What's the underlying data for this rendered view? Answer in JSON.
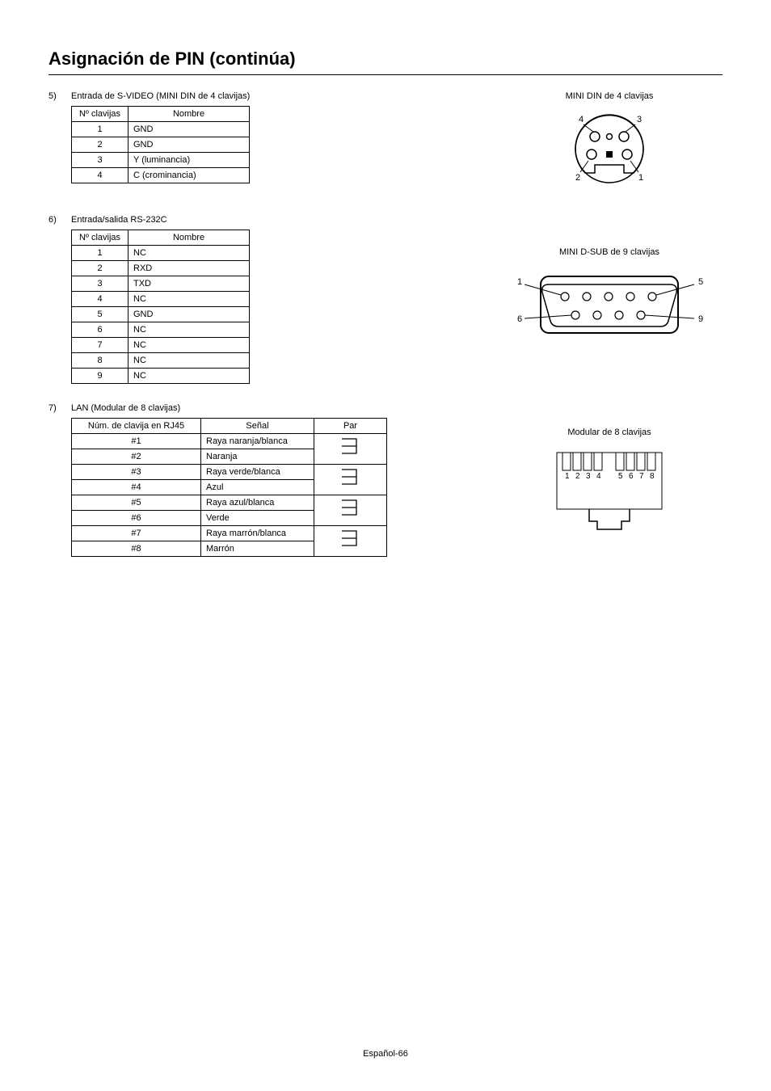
{
  "page_title": "Asignación de PIN (continúa)",
  "section5": {
    "num": "5)",
    "title": "Entrada de S-VIDEO (MINI DIN de 4 clavijas)",
    "diagram_title": "MINI DIN de 4 clavijas",
    "headers": [
      "Nº clavijas",
      "Nombre"
    ],
    "rows": [
      [
        "1",
        "GND"
      ],
      [
        "2",
        "GND"
      ],
      [
        "3",
        "Y (luminancia)"
      ],
      [
        "4",
        "C (crominancia)"
      ]
    ],
    "pin_labels": {
      "tl": "4",
      "tr": "3",
      "bl": "2",
      "br": "1"
    }
  },
  "section6": {
    "num": "6)",
    "title": "Entrada/salida RS-232C",
    "diagram_title": "MINI D-SUB de 9 clavijas",
    "headers": [
      "Nº clavijas",
      "Nombre"
    ],
    "rows": [
      [
        "1",
        "NC"
      ],
      [
        "2",
        "RXD"
      ],
      [
        "3",
        "TXD"
      ],
      [
        "4",
        "NC"
      ],
      [
        "5",
        "GND"
      ],
      [
        "6",
        "NC"
      ],
      [
        "7",
        "NC"
      ],
      [
        "8",
        "NC"
      ],
      [
        "9",
        "NC"
      ]
    ],
    "pin_labels": {
      "l1": "1",
      "r1": "5",
      "l2": "6",
      "r2": "9"
    }
  },
  "section7": {
    "num": "7)",
    "title": "LAN (Modular de 8 clavijas)",
    "diagram_title": "Modular de 8 clavijas",
    "headers": [
      "Núm. de clavija en RJ45",
      "Señal",
      "Par"
    ],
    "rows": [
      [
        "#1",
        "Raya naranja/blanca"
      ],
      [
        "#2",
        "Naranja"
      ],
      [
        "#3",
        "Raya verde/blanca"
      ],
      [
        "#4",
        "Azul"
      ],
      [
        "#5",
        "Raya azul/blanca"
      ],
      [
        "#6",
        "Verde"
      ],
      [
        "#7",
        "Raya marrón/blanca"
      ],
      [
        "#8",
        "Marrón"
      ]
    ],
    "pin_nums": [
      "1",
      "2",
      "3",
      "4",
      "5",
      "6",
      "7",
      "8"
    ]
  },
  "footer": "Español-66"
}
